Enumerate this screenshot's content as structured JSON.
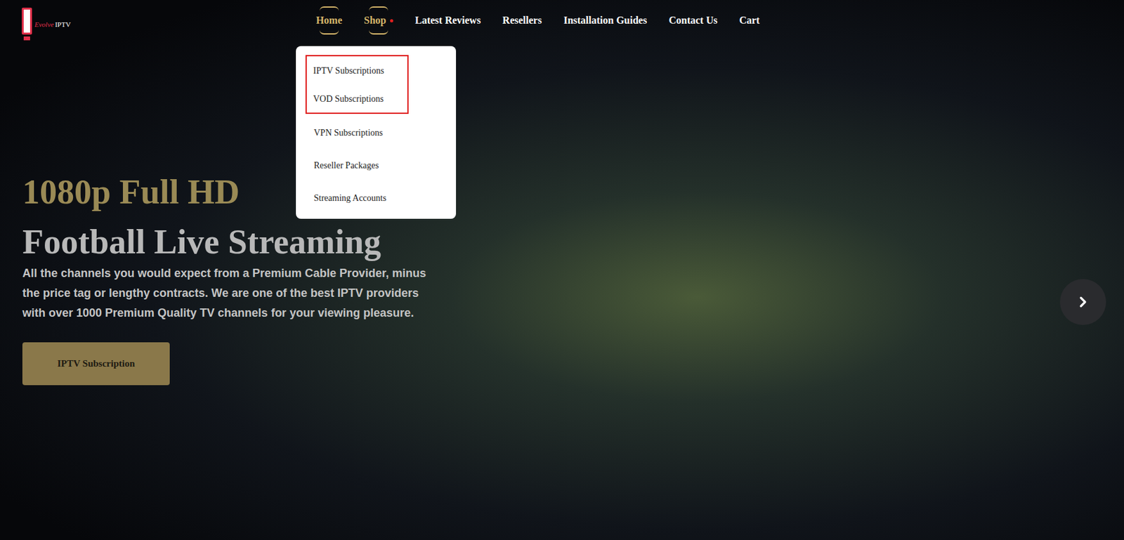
{
  "logo": {
    "script": "Evolve",
    "name": "IPTV"
  },
  "nav": [
    {
      "label": "Home",
      "selected": true,
      "dot": false
    },
    {
      "label": "Shop",
      "selected": true,
      "dot": true
    },
    {
      "label": "Latest Reviews",
      "selected": false,
      "dot": false
    },
    {
      "label": "Resellers",
      "selected": false,
      "dot": false
    },
    {
      "label": "Installation Guides",
      "selected": false,
      "dot": false
    },
    {
      "label": "Contact Us",
      "selected": false,
      "dot": false
    },
    {
      "label": "Cart",
      "selected": false,
      "dot": false
    }
  ],
  "dropdown": {
    "items": [
      {
        "label": "IPTV Subscriptions",
        "outlined": true
      },
      {
        "label": "VOD Subscriptions",
        "outlined": true
      },
      {
        "label": "VPN Subscriptions",
        "outlined": false
      },
      {
        "label": "Reseller Packages",
        "outlined": false
      },
      {
        "label": "Streaming Accounts",
        "outlined": false
      }
    ]
  },
  "hero": {
    "title_line1": "1080p Full HD",
    "title_line2": "Football Live Streaming",
    "description": "All the channels you would expect from a Premium Cable Provider, minus the price tag or lengthy contracts. We are one of the best IPTV providers with over 1000 Premium Quality TV channels for your viewing pleasure.",
    "button": "IPTV Subscription"
  }
}
